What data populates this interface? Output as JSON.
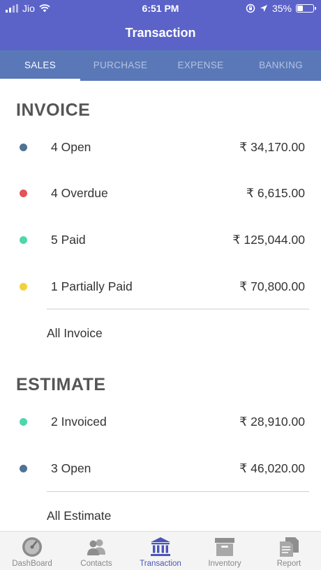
{
  "status_bar": {
    "carrier": "Jio",
    "time": "6:51 PM",
    "battery": "35%",
    "battery_level": 0.35
  },
  "header": {
    "title": "Transaction"
  },
  "tabs": [
    {
      "label": "SALES",
      "active": true
    },
    {
      "label": "PURCHASE",
      "active": false
    },
    {
      "label": "EXPENSE",
      "active": false
    },
    {
      "label": "BANKING",
      "active": false
    }
  ],
  "invoice": {
    "title": "INVOICE",
    "rows": [
      {
        "label": "4 Open",
        "amount": "₹ 34,170.00",
        "color": "#4f7396"
      },
      {
        "label": "4 Overdue",
        "amount": "₹ 6,615.00",
        "color": "#e2535a"
      },
      {
        "label": "5 Paid",
        "amount": "₹ 125,044.00",
        "color": "#4fd6ac"
      },
      {
        "label": "1 Partially Paid",
        "amount": "₹ 70,800.00",
        "color": "#f3d13e"
      }
    ],
    "link": "All Invoice"
  },
  "estimate": {
    "title": "ESTIMATE",
    "rows": [
      {
        "label": "2 Invoiced",
        "amount": "₹ 28,910.00",
        "color": "#4fd6ac"
      },
      {
        "label": "3 Open",
        "amount": "₹ 46,020.00",
        "color": "#4f7396"
      }
    ],
    "link": "All Estimate"
  },
  "bottom_nav": [
    {
      "label": "DashBoard",
      "icon": "dashboard-gauge-icon",
      "active": false
    },
    {
      "label": "Contacts",
      "icon": "contacts-icon",
      "active": false
    },
    {
      "label": "Transaction",
      "icon": "bank-icon",
      "active": true
    },
    {
      "label": "Inventory",
      "icon": "inventory-box-icon",
      "active": false
    },
    {
      "label": "Report",
      "icon": "report-icon",
      "active": false
    }
  ],
  "colors": {
    "header": "#5b63c9",
    "tabs": "#5a78b8",
    "accent": "#4a55b8"
  }
}
